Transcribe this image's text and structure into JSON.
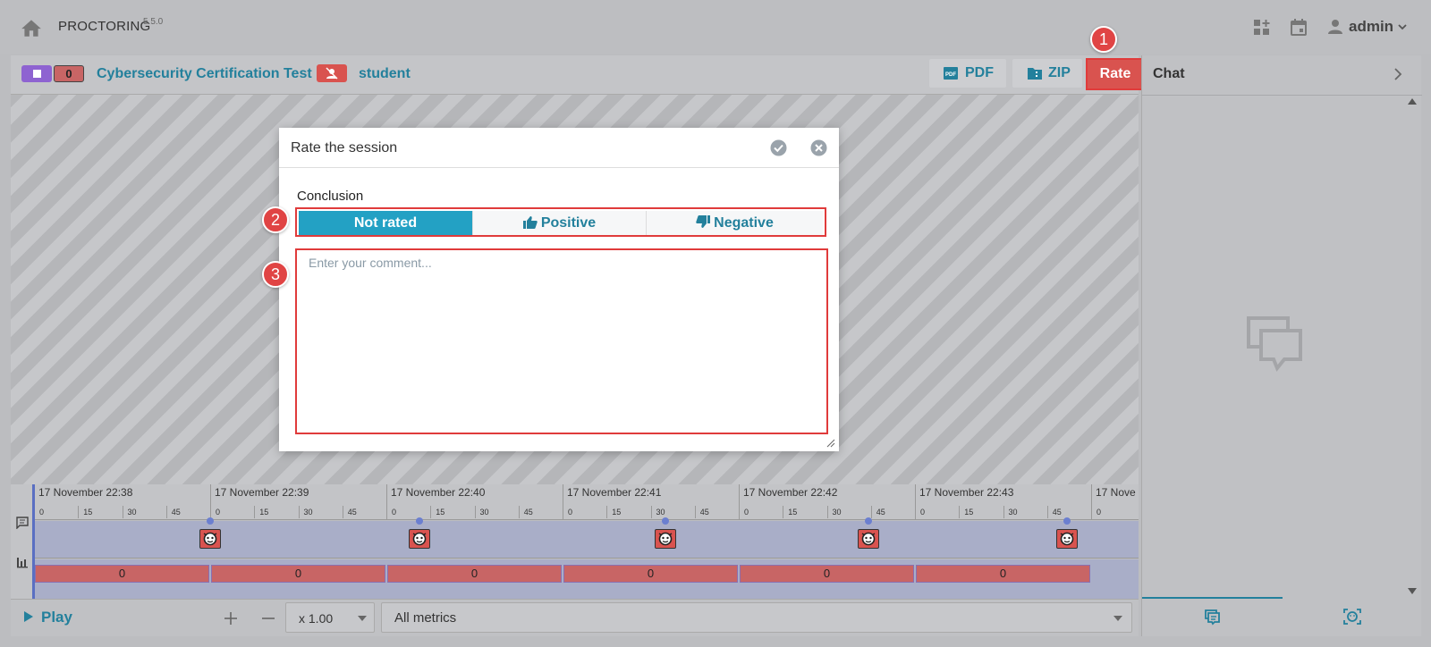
{
  "topbar": {
    "app_name": "PROCTORING",
    "version": "5.5.0",
    "user": "admin",
    "icons": [
      "home-icon",
      "dashboard-add-icon",
      "calendar-icon",
      "user-icon",
      "chevron-down-icon"
    ]
  },
  "session": {
    "status_count": "0",
    "title": "Cybersecurity Certification Test",
    "student": "student",
    "pdf_label": "PDF",
    "zip_label": "ZIP",
    "rate_label": "Rate"
  },
  "chat": {
    "title": "Chat"
  },
  "modal": {
    "title": "Rate the session",
    "conclusion_label": "Conclusion",
    "options": [
      "Not rated",
      "Positive",
      "Negative"
    ],
    "selected": "Not rated",
    "comment_placeholder": "Enter your comment..."
  },
  "timeline": {
    "minutes": [
      "17 November 22:38",
      "17 November 22:39",
      "17 November 22:40",
      "17 November 22:41",
      "17 November 22:42",
      "17 November 22:43",
      "17 Nove"
    ],
    "seconds": [
      "0",
      "15",
      "30",
      "45"
    ],
    "metric_values": [
      "0",
      "0",
      "0",
      "0",
      "0",
      "0"
    ]
  },
  "controls": {
    "play_label": "Play",
    "speed": "x 1.00",
    "metrics": "All metrics"
  },
  "markers": [
    "1",
    "2",
    "3"
  ],
  "colors": {
    "accent": "#23809c",
    "active_segment": "#23a1c4",
    "rate_button": "#d9534f",
    "highlight": "#e03b3b"
  }
}
